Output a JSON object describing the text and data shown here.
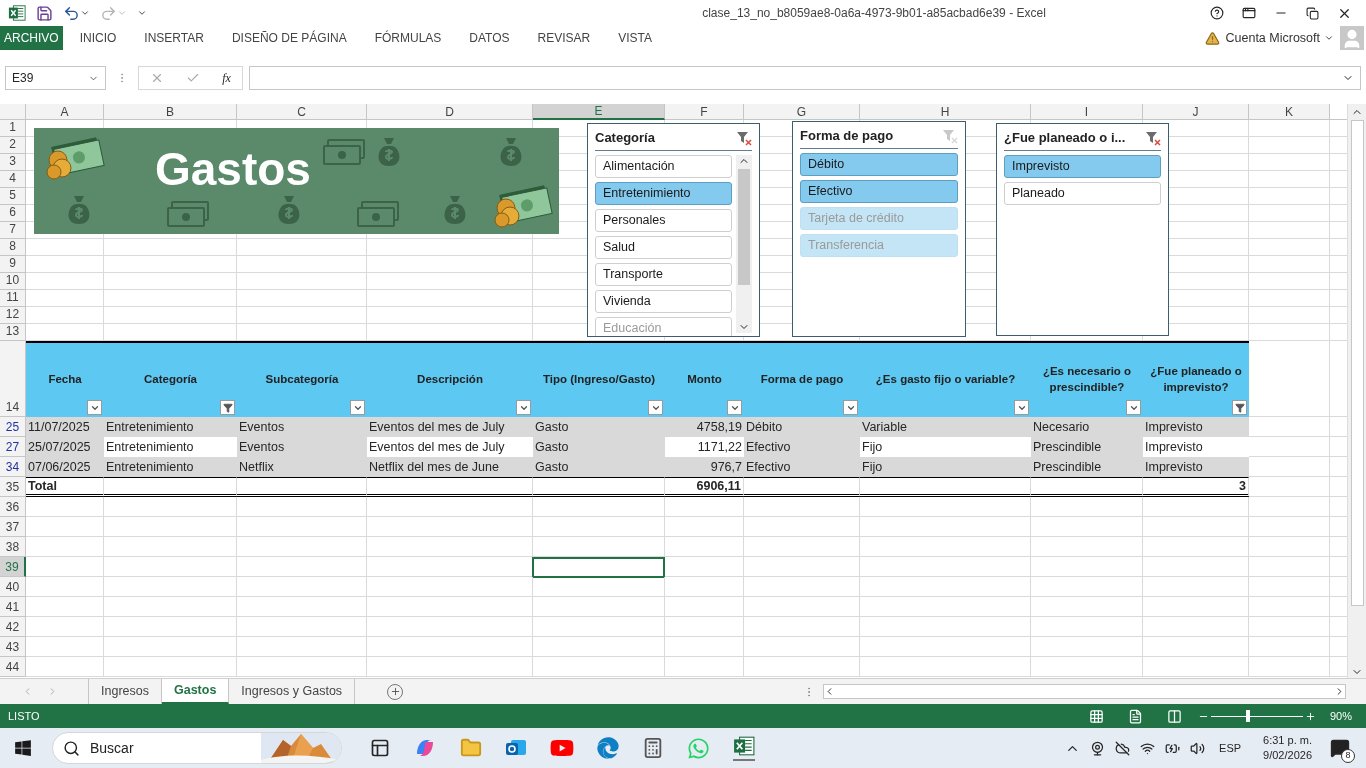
{
  "window": {
    "title": "clase_13_no_b8059ae8-0a6a-4973-9b01-a85acbad6e39 - Excel"
  },
  "ribbon": {
    "file_tab": "ARCHIVO",
    "tabs": [
      "INICIO",
      "INSERTAR",
      "DISEÑO DE PÁGINA",
      "FÓRMULAS",
      "DATOS",
      "REVISAR",
      "VISTA"
    ],
    "account": "Cuenta Microsoft"
  },
  "formula_bar": {
    "name_box": "E39",
    "function_button": "fx"
  },
  "sheet": {
    "columns": [
      {
        "label": "A",
        "selected": false
      },
      {
        "label": "B",
        "selected": false
      },
      {
        "label": "C",
        "selected": false
      },
      {
        "label": "D",
        "selected": false
      },
      {
        "label": "E",
        "selected": true
      },
      {
        "label": "F",
        "selected": false
      },
      {
        "label": "G",
        "selected": false
      },
      {
        "label": "H",
        "selected": false
      },
      {
        "label": "I",
        "selected": false
      },
      {
        "label": "J",
        "selected": false
      },
      {
        "label": "K",
        "selected": false
      }
    ],
    "top_rows": [
      "1",
      "2",
      "3",
      "4",
      "5",
      "6",
      "7",
      "8",
      "9",
      "10",
      "11",
      "12",
      "13"
    ],
    "header_row": "14",
    "empty_rows": [
      {
        "label": "36",
        "selected": false
      },
      {
        "label": "37",
        "selected": false
      },
      {
        "label": "38",
        "selected": false
      },
      {
        "label": "39",
        "selected": true
      },
      {
        "label": "40",
        "selected": false
      },
      {
        "label": "41",
        "selected": false
      },
      {
        "label": "42",
        "selected": false
      },
      {
        "label": "43",
        "selected": false
      },
      {
        "label": "44",
        "selected": false
      }
    ]
  },
  "banner": {
    "title": "Gastos"
  },
  "slicers": [
    {
      "title": "Categoría",
      "filtered": true,
      "scrollable": true,
      "items": [
        {
          "label": "Alimentación",
          "selected": false,
          "disabled": false
        },
        {
          "label": "Entretenimiento",
          "selected": true,
          "disabled": false
        },
        {
          "label": "Personales",
          "selected": false,
          "disabled": false
        },
        {
          "label": "Salud",
          "selected": false,
          "disabled": false
        },
        {
          "label": "Transporte",
          "selected": false,
          "disabled": false
        },
        {
          "label": "Vivienda",
          "selected": false,
          "disabled": false
        },
        {
          "label": "Educación",
          "selected": false,
          "disabled": true
        }
      ]
    },
    {
      "title": "Forma de pago",
      "filtered": false,
      "scrollable": false,
      "items": [
        {
          "label": "Débito",
          "selected": true,
          "disabled": false
        },
        {
          "label": "Efectivo",
          "selected": true,
          "disabled": false
        },
        {
          "label": "Tarjeta de crédito",
          "selected": true,
          "disabled": true
        },
        {
          "label": "Transferencia",
          "selected": true,
          "disabled": true
        }
      ]
    },
    {
      "title": "¿Fue planeado o i...",
      "filtered": true,
      "scrollable": false,
      "items": [
        {
          "label": "Imprevisto",
          "selected": true,
          "disabled": false
        },
        {
          "label": "Planeado",
          "selected": false,
          "disabled": false
        }
      ]
    }
  ],
  "table": {
    "columns": [
      {
        "label": "Fecha",
        "filtered": false,
        "kind": "text"
      },
      {
        "label": "Categoría",
        "filtered": true,
        "kind": "text"
      },
      {
        "label": "Subcategoría",
        "filtered": false,
        "kind": "text"
      },
      {
        "label": "Descripción",
        "filtered": false,
        "kind": "text"
      },
      {
        "label": "Tipo (Ingreso/Gasto)",
        "filtered": false,
        "kind": "text"
      },
      {
        "label": "Monto",
        "filtered": false,
        "kind": "number"
      },
      {
        "label": "Forma de pago",
        "filtered": false,
        "kind": "text"
      },
      {
        "label": "¿Es gasto fijo o variable?",
        "filtered": false,
        "kind": "text"
      },
      {
        "label": "¿Es necesario o prescindible?",
        "filtered": false,
        "kind": "text"
      },
      {
        "label": "¿Fue planeado o imprevisto?",
        "filtered": true,
        "kind": "text"
      }
    ],
    "rows": [
      {
        "number": "25",
        "cells": [
          "11/07/2025",
          "Entretenimiento",
          "Eventos",
          "Eventos del mes de July",
          "Gasto",
          "4758,19",
          "Débito",
          "Variable",
          "Necesario",
          "Imprevisto"
        ],
        "white_cells": [
          false,
          false,
          false,
          false,
          false,
          false,
          false,
          false,
          false,
          false
        ]
      },
      {
        "number": "27",
        "cells": [
          "25/07/2025",
          "Entretenimiento",
          "Eventos",
          "Eventos del mes de July",
          "Gasto",
          "1171,22",
          "Efectivo",
          "Fijo",
          "Prescindible",
          "Imprevisto"
        ],
        "white_cells": [
          false,
          true,
          false,
          true,
          false,
          true,
          false,
          true,
          false,
          true
        ]
      },
      {
        "number": "34",
        "cells": [
          "07/06/2025",
          "Entretenimiento",
          "Netflix",
          "Netflix del mes de June",
          "Gasto",
          "976,7",
          "Efectivo",
          "Fijo",
          "Prescindible",
          "Imprevisto"
        ],
        "white_cells": [
          false,
          false,
          false,
          false,
          false,
          false,
          false,
          false,
          false,
          false
        ]
      }
    ],
    "total": {
      "number": "35",
      "label": "Total",
      "amount": "6906,11",
      "count": "3"
    }
  },
  "sheet_tabs": [
    {
      "label": "Ingresos",
      "selected": false
    },
    {
      "label": "Gastos",
      "selected": true
    },
    {
      "label": "Ingresos y Gastos",
      "selected": false
    }
  ],
  "status_bar": {
    "text": "LISTO",
    "zoom": "90%",
    "zoom_slider": {
      "level": 0.4
    }
  },
  "taskbar": {
    "search": {
      "placeholder": "Buscar"
    },
    "language": "ESP",
    "time": "6:31 p. m.",
    "date": "9/02/2026",
    "notifications": "8"
  }
}
